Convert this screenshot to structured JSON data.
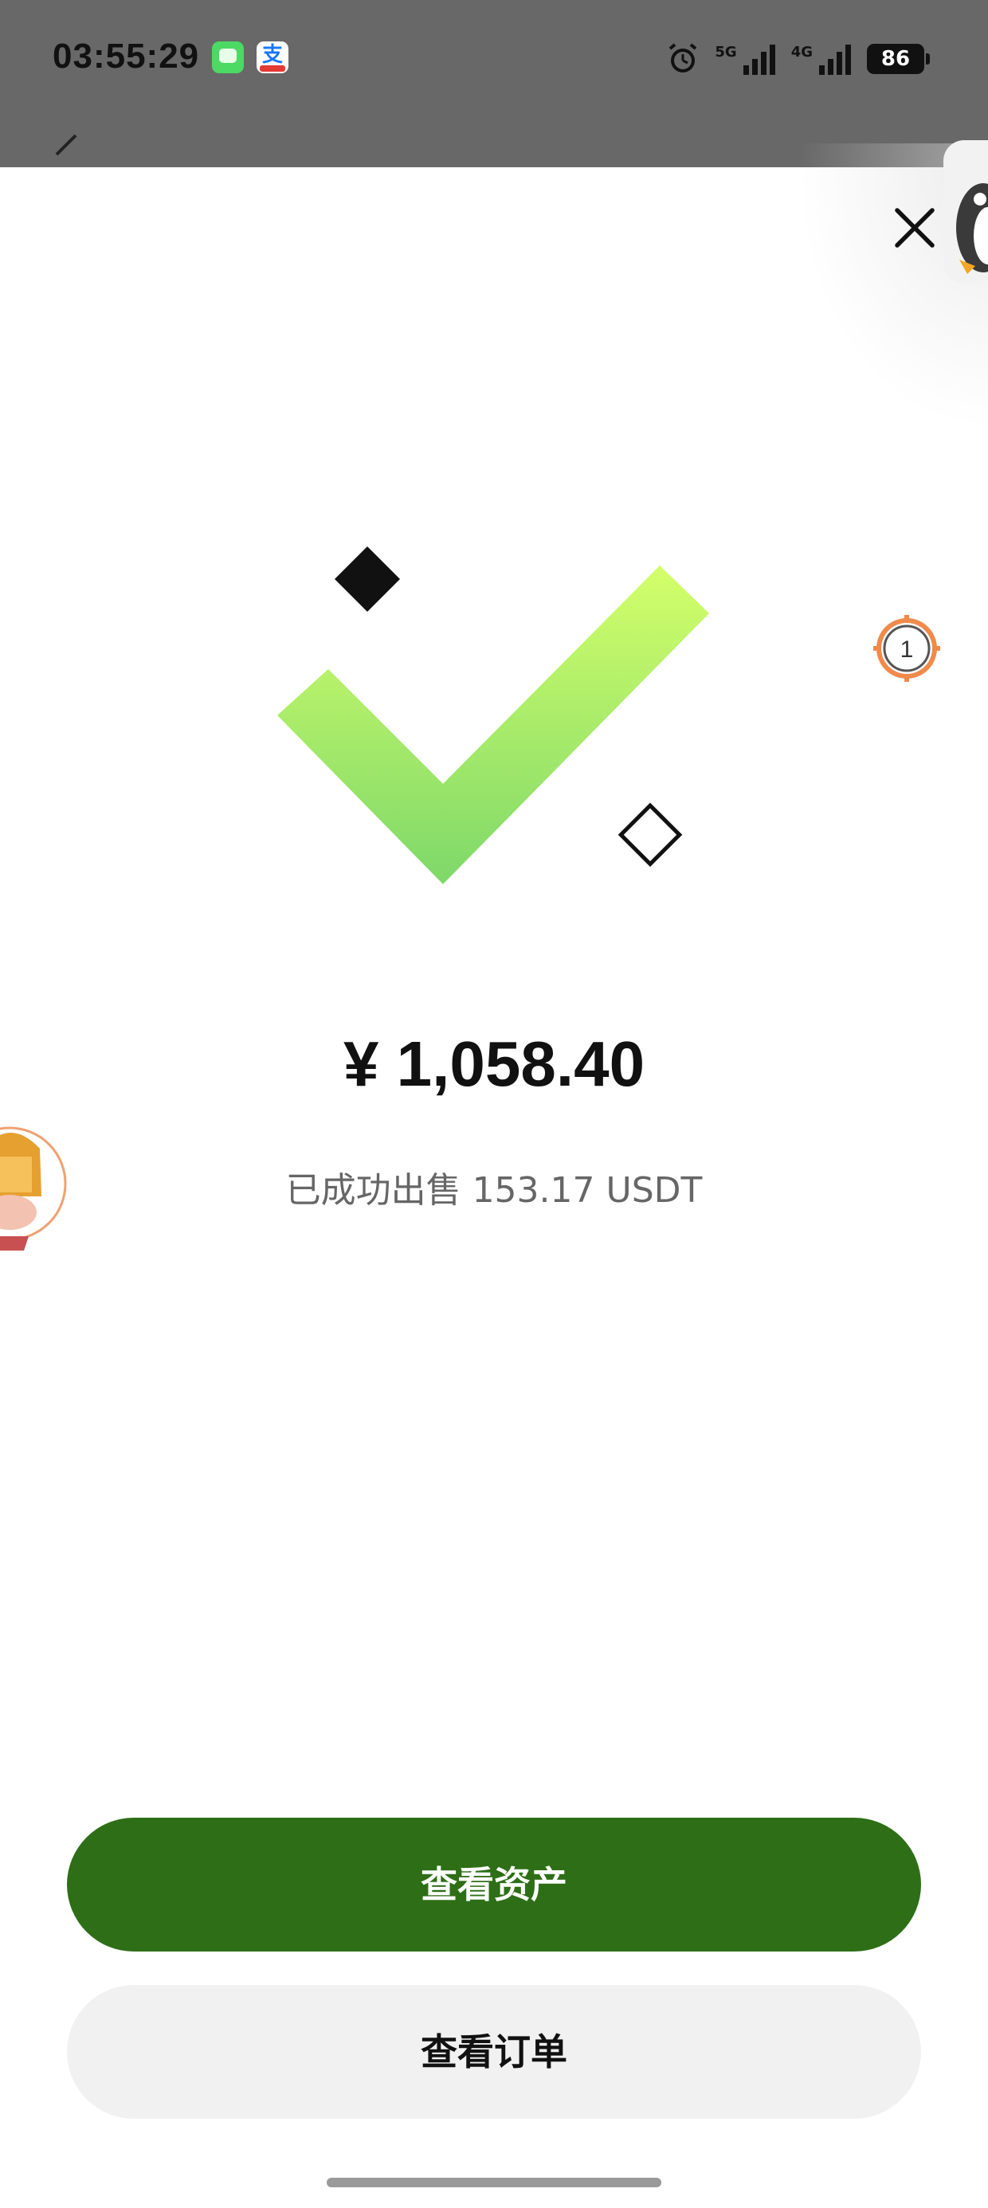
{
  "status_bar": {
    "time": "03:55:29",
    "signal_1_label": "5G",
    "signal_2_label": "4G",
    "battery_level": "86",
    "icons": [
      "messages-app-icon",
      "alipay-app-icon",
      "alarm-icon",
      "signal-5g-icon",
      "signal-4g-icon",
      "battery-icon"
    ]
  },
  "result": {
    "amount": "¥ 1,058.40",
    "sold_text": "已成功出售 153.17 USDT"
  },
  "side_badge": {
    "count": "1"
  },
  "buttons": {
    "view_assets": "查看资产",
    "view_orders": "查看订单"
  },
  "colors": {
    "primary_button": "#2e6e17",
    "secondary_button": "#f1f1f1",
    "check_gradient_top": "#d4ff6a",
    "check_gradient_bottom": "#7ed86a",
    "status_bar_bg": "#686868",
    "badge_accent": "#f08a4b"
  }
}
